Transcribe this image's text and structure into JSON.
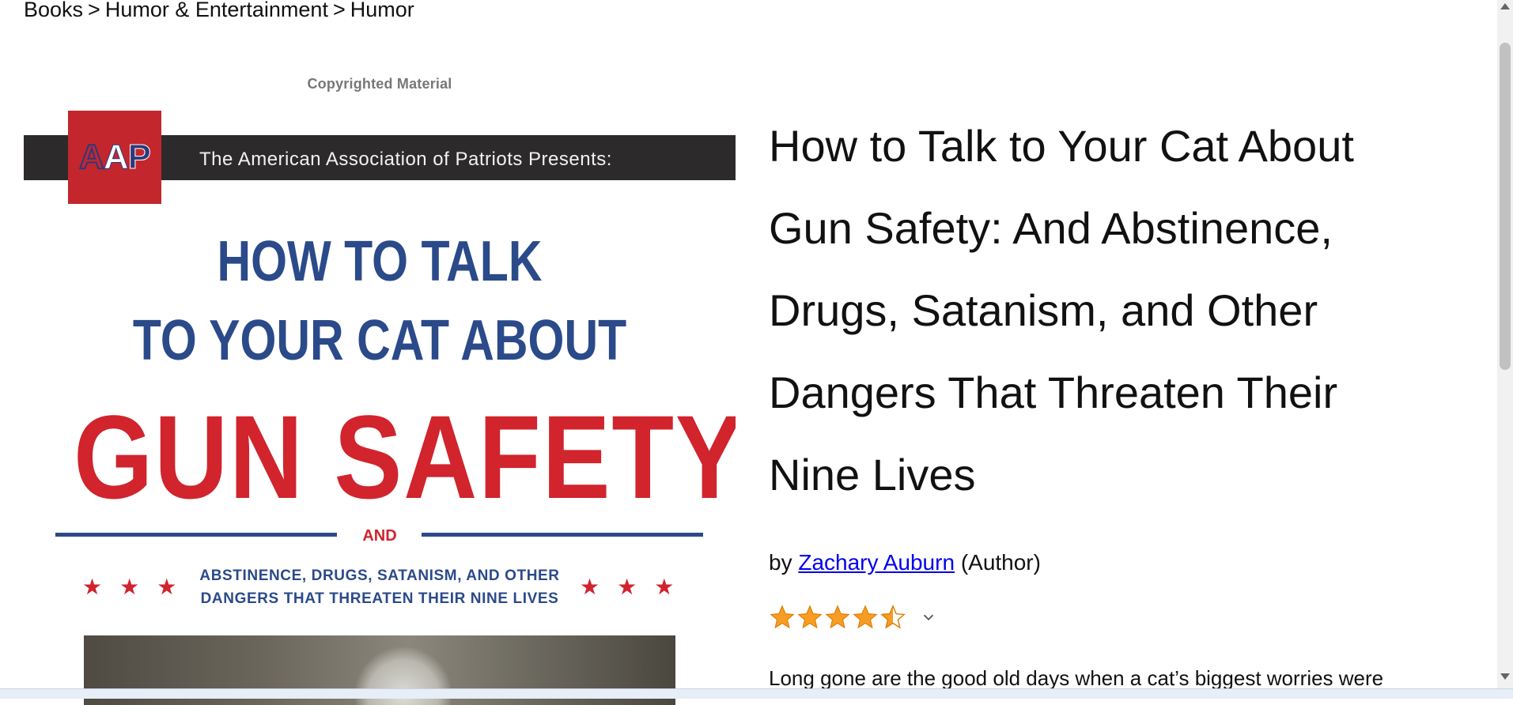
{
  "breadcrumb": {
    "items": [
      "Books",
      "Humor & Entertainment",
      "Humor"
    ],
    "separator": ">"
  },
  "cover": {
    "copyright": "Copyrighted Material",
    "logo": "AAP",
    "presents": "The American Association of Patriots Presents:",
    "title_line1": "HOW TO TALK",
    "title_line2": "TO YOUR CAT ABOUT",
    "title_line3": "GUN SAFETY",
    "and": "AND",
    "subtitle_line1": "ABSTINENCE, DRUGS, SATANISM, AND OTHER",
    "subtitle_line2": "DANGERS THAT THREATEN THEIR NINE LIVES",
    "stars": "★★★",
    "colors": {
      "red": "#d1242d",
      "blue": "#2b4a8a",
      "band": "#2d2a2b"
    }
  },
  "product": {
    "title": "How to Talk to Your Cat About Gun Safety: And Abstinence, Drugs, Satanism, and Other Dangers That Threaten Their Nine Lives",
    "by": "by",
    "author": "Zachary Auburn",
    "role": "(Author)",
    "rating": 4.5,
    "rating_max": 5,
    "star_color": "#f79d25",
    "description_start": "Long gone are the good old days when a cat’s biggest worries were"
  }
}
